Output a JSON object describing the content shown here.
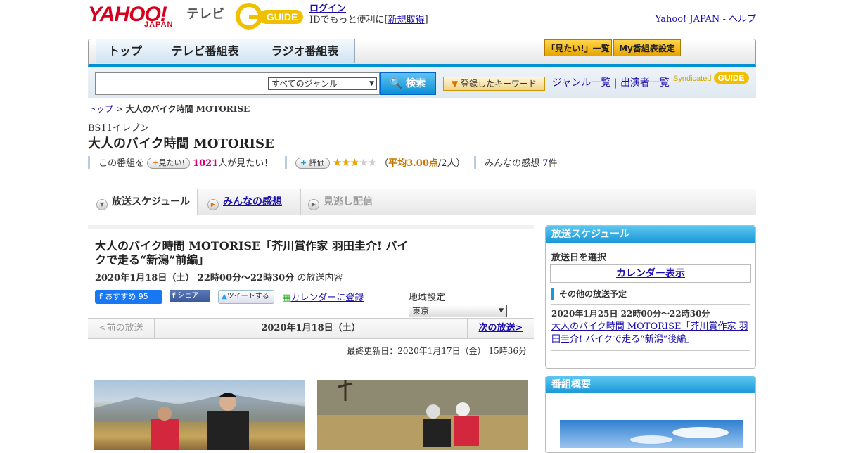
{
  "header": {
    "logo_yahoo": "YAHOO!",
    "logo_japan": "JAPAN",
    "logo_tv": "テレビ",
    "guide_logo": "GUIDE",
    "login": "ログイン",
    "login_note_pre": "IDでもっと便利に[",
    "register": "新規取得",
    "login_note_post": "]",
    "yahoo_japan_link": "Yahoo! JAPAN",
    "sep": "-",
    "help_link": "ヘルプ"
  },
  "nav": {
    "tabs": [
      "トップ",
      "テレビ番組表",
      "ラジオ番組表"
    ],
    "want_list": "「見たい!」一覧",
    "my_schedule": "My番組表設定"
  },
  "search": {
    "genre_select": "すべてのジャンル",
    "button": "検索",
    "keyword_button": "登録したキーワード",
    "genre_list": "ジャンル一覧",
    "divider": "|",
    "cast_list": "出演者一覧",
    "syndicated": "Syndicated"
  },
  "breadcrumb": {
    "top": "トップ",
    "sep": ">",
    "current": "大人のバイク時間 MOTORISE"
  },
  "program": {
    "channel": "BS11イレブン",
    "title": "大人のバイク時間 MOTORISE",
    "want_label": "この番組を",
    "want_button": "見たい!",
    "want_count": "1021",
    "want_suffix": "人が見たい！",
    "rate_button": "評価",
    "rating_open": "（",
    "rating_avg": "平均3.00点",
    "rating_count": "/2人）",
    "reviews_label": "みんなの感想",
    "reviews_count": "7",
    "reviews_unit": "件",
    "rating_value": 3,
    "rating_max": 5
  },
  "content_tabs": {
    "schedule": "放送スケジュール",
    "reviews": "みんなの感想",
    "streaming": "見逃し配信"
  },
  "episode": {
    "title": "大人のバイク時間 MOTORISE「芥川賞作家 羽田圭介! バイクで走る“新潟”前編」",
    "datetime": "2020年1月18日（土） 22時00分～22時30分",
    "datetime_suffix": "の放送内容",
    "fb_recommend": "おすすめ",
    "fb_count": "95",
    "fb_share": "シェア",
    "tweet": "ツイートする",
    "calendar": "カレンダーに登録",
    "region_label": "地域設定",
    "region_value": "東京",
    "prev": "<前の放送",
    "current_date": "2020年1月18日（土）",
    "next": "次の放送>",
    "updated": "最終更新日：2020年1月17日（金） 15時36分"
  },
  "sidebar": {
    "schedule_title": "放送スケジュール",
    "select_date": "放送日を選択",
    "calendar_button": "カレンダー表示",
    "other_title": "その他の放送予定",
    "other_date": "2020年1月25日 22時00分～22時30分",
    "other_link": "大人のバイク時間 MOTORISE「芥川賞作家 羽田圭介! バイクで走る“新潟”後編」",
    "summary_title": "番組概要"
  },
  "colors": {
    "accent_blue": "#0091d5",
    "yahoo_red": "#d6001c",
    "star_gold": "#e8a400"
  }
}
